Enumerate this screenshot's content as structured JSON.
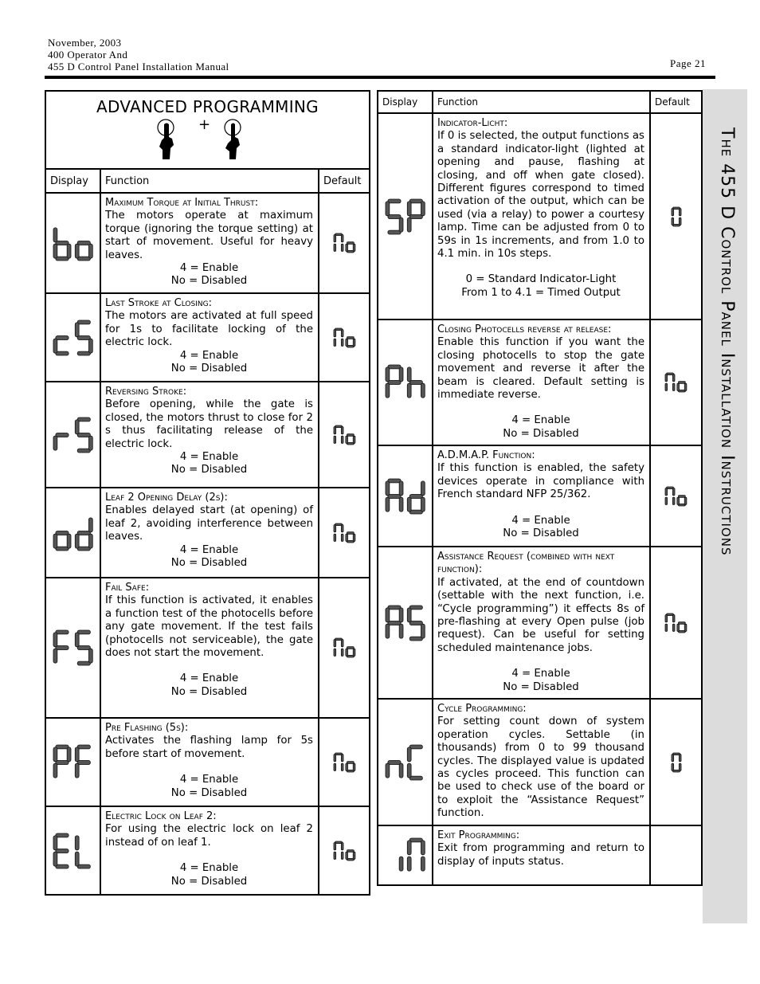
{
  "header": {
    "lines": [
      "November, 2003",
      "400 Operator And",
      "455 D Control Panel Installation Manual"
    ],
    "page": "Page 21"
  },
  "sidebar": {
    "title": "The 455 D Control Panel Installation Instructions"
  },
  "left_table": {
    "title": "ADVANCED PROGRAMMING",
    "plus": "+",
    "columns": [
      "Display",
      "Function",
      "Default"
    ],
    "rows": [
      {
        "display": "bo",
        "title": "Maximum Torque at Initial Thrust:",
        "body": [
          "The motors operate at maximum torque (ignoring the torque setting) at start of movement.  Useful for heavy leaves."
        ],
        "options": [
          "4 = Enable",
          "No = Disabled"
        ],
        "default": "no"
      },
      {
        "display": "cS",
        "title": "Last Stroke at Closing:",
        "body": [
          "The motors are activated at full speed for 1s to facilitate locking of the electric lock."
        ],
        "options": [
          "4 = Enable",
          "No = Disabled"
        ],
        "default": "no"
      },
      {
        "display": "rS",
        "title": "Reversing Stroke:",
        "body": [
          "Before opening, while the gate is closed, the motors thrust to close for 2 s thus facilitating release of the electric lock."
        ],
        "options": [
          "4 = Enable",
          "No = Disabled"
        ],
        "default": "no"
      },
      {
        "display": "od",
        "title": "Leaf 2 Opening Delay (2s):",
        "body": [
          "Enables delayed start (at opening) of leaf 2, avoiding interference between leaves."
        ],
        "options": [
          "4 = Enable",
          "No = Disabled"
        ],
        "default": "no"
      },
      {
        "display": "FS",
        "title": "Fail Safe:",
        "body": [
          "If this function is activated, it enables a function test of the photocells before any gate movement.  If the test fails (photocells not serviceable), the gate does not start the movement.",
          ""
        ],
        "options": [
          "4 = Enable",
          "No = Disabled"
        ],
        "default": "no"
      },
      {
        "display": "PF",
        "title": "Pre Flashing (5s):",
        "body": [
          "Activates the flashing lamp for 5s before start of movement.",
          ""
        ],
        "options": [
          "4 = Enable",
          "No = Disabled"
        ],
        "default": "no"
      },
      {
        "display": "EL",
        "title": "Electric Lock on Leaf 2:",
        "body": [
          "For using the electric lock on leaf 2 instead of on leaf 1.",
          ""
        ],
        "options": [
          "4 = Enable",
          "No = Disabled"
        ],
        "default": "no"
      }
    ]
  },
  "right_table": {
    "columns": [
      "Display",
      "Function",
      "Default"
    ],
    "rows": [
      {
        "display": "SP",
        "title": "Indicator-Licht:",
        "body": [
          "If 0 is selected, the output functions as a standard indicator-light (lighted at opening and pause, flashing at closing, and off when gate closed). Different figures correspond to timed activation of the output, which can be used (via a relay) to power a courtesy lamp.  Time can be adjusted from 0 to 59s in 1s increments, and from 1.0 to 4.1 min. in 10s steps.",
          ""
        ],
        "options": [
          "0 = Standard Indicator-Light",
          "From 1 to 4.1 = Timed Output",
          ""
        ],
        "default": "0"
      },
      {
        "display": "Ph",
        "title": "Closing Photocells reverse at release:",
        "body": [
          "Enable this function if you want the closing photocells to stop the gate movement and reverse it after the beam is cleared. Default setting is immediate reverse.",
          ""
        ],
        "options": [
          "4 = Enable",
          "No = Disabled"
        ],
        "default": "no"
      },
      {
        "display": "Ad",
        "title": "A.D.M.A.P. Function:",
        "body": [
          "If this function is enabled, the safety devices operate in compliance with French standard NFP 25/362.",
          ""
        ],
        "options": [
          "4 = Enable",
          "No = Disabled"
        ],
        "default": "no"
      },
      {
        "display": "AS",
        "title": "Assistance Request (combined with next function):",
        "body": [
          "If activated, at the end of countdown (settable with the next function, i.e. “Cycle programming”) it effects 8s of pre-flashing at every Open pulse (job request).  Can be useful for setting scheduled maintenance jobs.",
          ""
        ],
        "options": [
          "4 = Enable",
          "No = Disabled"
        ],
        "default": "no"
      },
      {
        "display": "nC",
        "title": "Cycle Programming:",
        "body": [
          "For setting count down of system operation cycles.  Settable (in thousands) from 0 to 99 thousand cycles. The displayed value is updated as cycles proceed.  This function can be used to check use of the board or to exploit the “Assistance Request” function."
        ],
        "options": [],
        "default": "0"
      },
      {
        "display": "in",
        "title": "Exit Programming:",
        "body": [
          "Exit from programming and return to display of inputs status.",
          ""
        ],
        "options": [],
        "default": ""
      }
    ]
  },
  "colors": {
    "segment": "#555555",
    "sidebar": "#dcdcdc"
  }
}
